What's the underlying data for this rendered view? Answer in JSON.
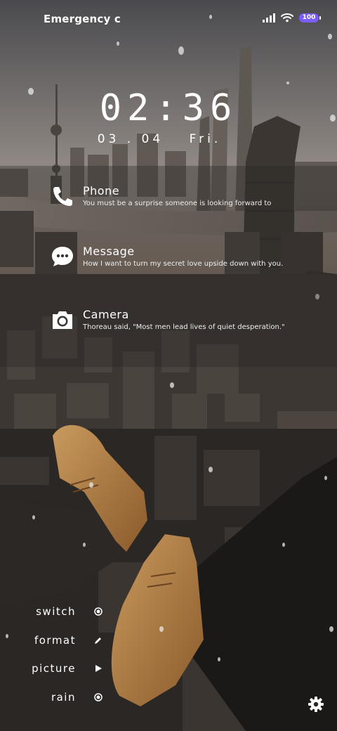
{
  "status_bar": {
    "left_text": "Emergency c",
    "battery": "100",
    "icons": [
      "signal-icon",
      "wifi-icon",
      "battery-icon"
    ]
  },
  "clock": {
    "hour": "02",
    "minute": "36",
    "date": "03 . 04",
    "weekday": "Fri."
  },
  "notifications": [
    {
      "title": "Phone",
      "body": "You must be a surprise someone is looking forward to",
      "icon": "phone-icon"
    },
    {
      "title": "Message",
      "body": "How I want to turn my secret love upside down with you.",
      "icon": "message-icon"
    },
    {
      "title": "Camera",
      "body": "Thoreau said, \"Most men lead lives of quiet desperation.\"",
      "icon": "camera-icon"
    }
  ],
  "menu": [
    {
      "label": "switch",
      "icon": "radio-icon"
    },
    {
      "label": "format",
      "icon": "pen-icon"
    },
    {
      "label": "picture",
      "icon": "play-icon"
    },
    {
      "label": "rain",
      "icon": "radio-icon"
    }
  ],
  "settings_icon": "gear-icon",
  "colors": {
    "battery": "#7b5cff",
    "text": "#ffffff"
  }
}
